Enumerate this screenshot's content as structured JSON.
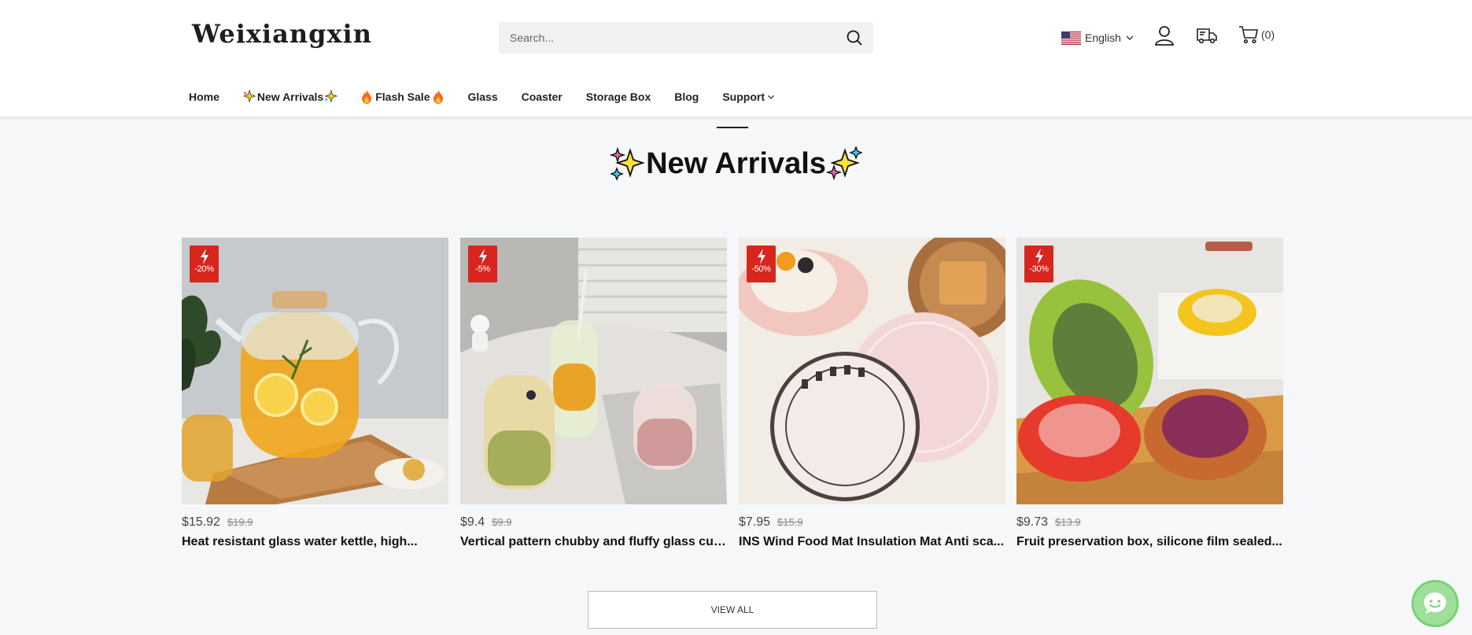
{
  "header": {
    "logo": "Weixiangxin",
    "search_placeholder": "Search...",
    "language": "English",
    "cart_count": "(0)",
    "icons": [
      "search-icon",
      "us-flag-icon",
      "chevron-down-icon",
      "user-icon",
      "delivery-truck-icon",
      "shopping-cart-icon"
    ]
  },
  "nav": {
    "items": [
      "Home",
      "New Arrivals",
      "Flash Sale",
      "Glass",
      "Coaster",
      "Storage Box",
      "Blog",
      "Support"
    ]
  },
  "section": {
    "title": "New Arrivals",
    "view_all": "VIEW ALL"
  },
  "products": [
    {
      "discount": "-20%",
      "price": "$15.92",
      "old_price": "$19.9",
      "title": "Heat resistant glass water kettle, high..."
    },
    {
      "discount": "-5%",
      "price": "$9.4",
      "old_price": "$9.9",
      "title": "Vertical pattern chubby and fluffy glass cup..."
    },
    {
      "discount": "-50%",
      "price": "$7.95",
      "old_price": "$15.9",
      "title": "INS Wind Food Mat Insulation Mat Anti sca..."
    },
    {
      "discount": "-30%",
      "price": "$9.73",
      "old_price": "$13.9",
      "title": "Fruit preservation box, silicone film sealed..."
    }
  ],
  "colors": {
    "badge": "#d7261e",
    "chat": "#9ee09a",
    "background": "#f6f7f9"
  }
}
